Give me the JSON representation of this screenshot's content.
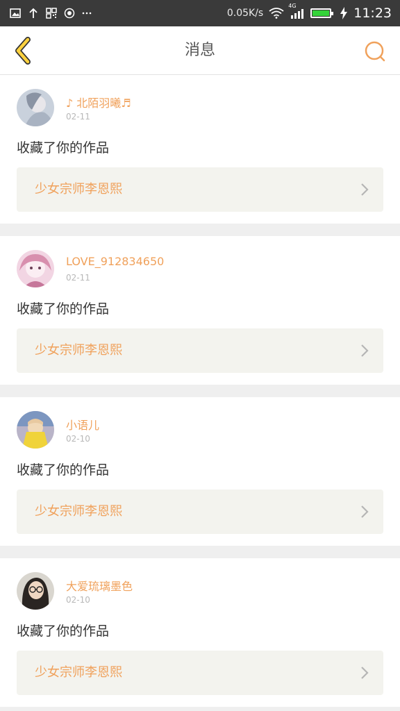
{
  "status_bar": {
    "net_speed": "0.05K/s",
    "network_type": "4G",
    "time": "11:23",
    "battery_level": 1.0,
    "icons": [
      "image-icon",
      "upload-icon",
      "qr-icon",
      "record-icon",
      "more-icon",
      "wifi-icon",
      "signal-icon",
      "battery-icon",
      "charging-icon"
    ]
  },
  "nav": {
    "title": "消息",
    "back_icon": "chevron-left-icon",
    "search_icon": "search-icon"
  },
  "colors": {
    "accent": "#f0a15b",
    "back_icon": "#ffd23f",
    "work_box_bg": "#f3f3ee",
    "page_bg": "#efefef"
  },
  "messages": [
    {
      "username": "♪ 北陌羽曦♬",
      "date": "02-11",
      "action": "收藏了你的作品",
      "work_title": "少女宗师李恩熙"
    },
    {
      "username": "LOVE_912834650",
      "date": "02-11",
      "action": "收藏了你的作品",
      "work_title": "少女宗师李恩熙"
    },
    {
      "username": "小语儿",
      "date": "02-10",
      "action": "收藏了你的作品",
      "work_title": "少女宗师李恩熙"
    },
    {
      "username": "大爱琉璃墨色",
      "date": "02-10",
      "action": "收藏了你的作品",
      "work_title": "少女宗师李恩熙"
    }
  ]
}
